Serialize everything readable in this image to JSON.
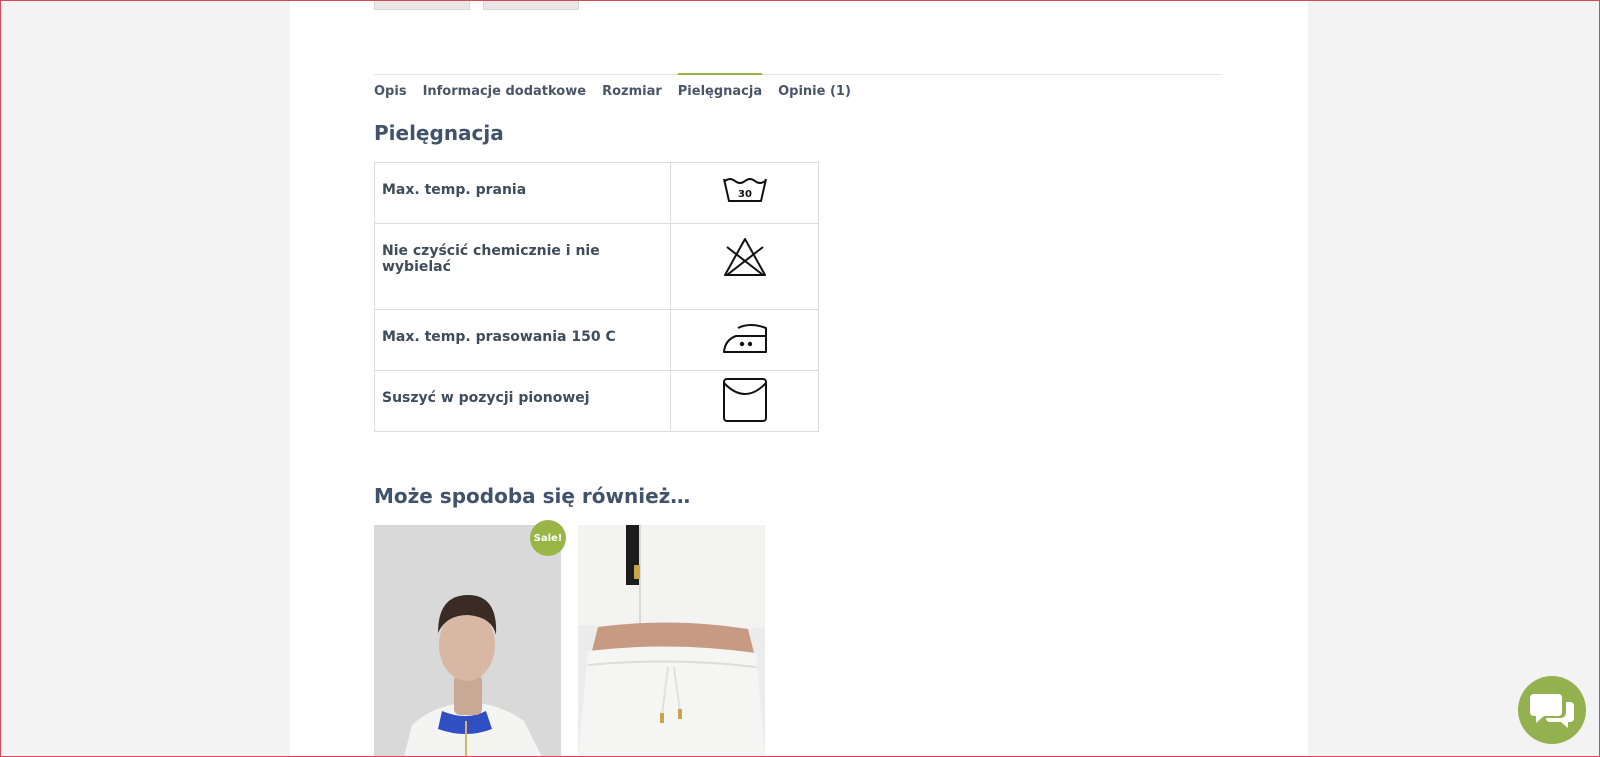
{
  "tabs": [
    {
      "label": "Opis",
      "active": false
    },
    {
      "label": "Informacje dodatkowe",
      "active": false
    },
    {
      "label": "Rozmiar",
      "active": false
    },
    {
      "label": "Pielęgnacja",
      "active": true
    },
    {
      "label": "Opinie (1)",
      "active": false
    }
  ],
  "care": {
    "title": "Pielęgnacja",
    "rows": [
      {
        "label": "Max. temp. prania",
        "icon": "wash-30-icon",
        "icon_text": "30"
      },
      {
        "label": "Nie czyścić chemicznie i nie wybielać",
        "icon": "no-bleach-icon"
      },
      {
        "label": "Max. temp. prasowania 150 C",
        "icon": "iron-two-dots-icon"
      },
      {
        "label": "Suszyć w pozycji pionowej",
        "icon": "line-dry-icon"
      }
    ]
  },
  "related": {
    "title": "Może spodoba się również…",
    "products": [
      {
        "badge": "Sale!",
        "image": "man-white-jacket-photo"
      },
      {
        "image": "white-tracksuit-photo"
      }
    ]
  },
  "colors": {
    "accent": "#98b545",
    "chat": "#93b14f"
  },
  "chat": {
    "icon": "chat-bubbles-icon"
  }
}
